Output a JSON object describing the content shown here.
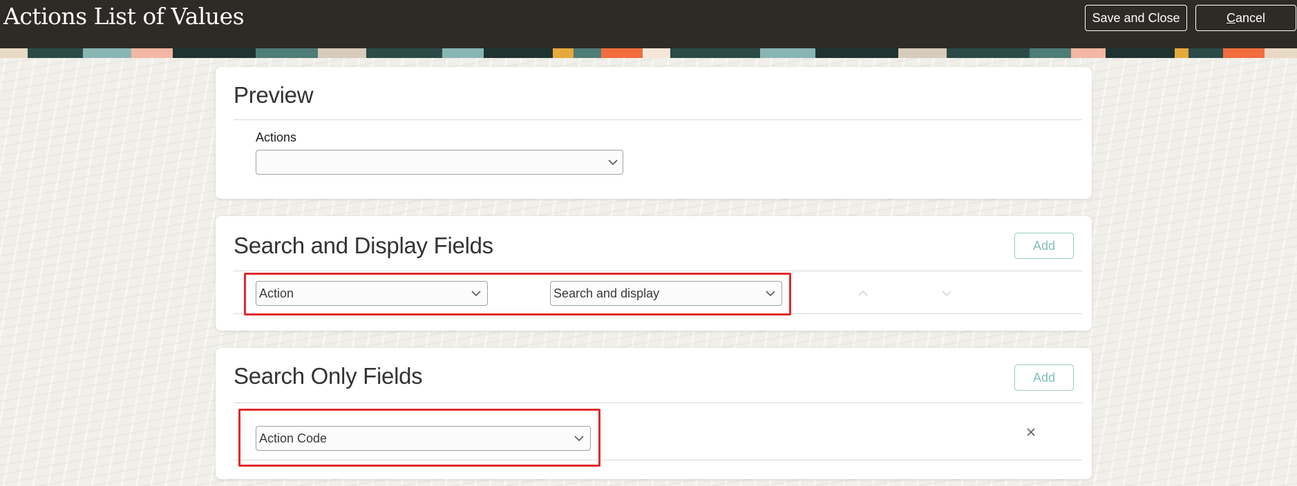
{
  "header": {
    "title": "Actions List of Values",
    "save_label": "Save and Close",
    "cancel_accel": "C",
    "cancel_rest": "ancel",
    "banner_colors": [
      "#2b4a48",
      "#e8d9c4",
      "#88b6b3",
      "#f26d3d",
      "#f3b7a3",
      "#1f3331",
      "#d7ccbc",
      "#e7a93b",
      "#4e7c77",
      "#f7e7d9"
    ]
  },
  "preview": {
    "title": "Preview",
    "field_label": "Actions",
    "field_value": ""
  },
  "search_display": {
    "title": "Search and Display Fields",
    "add_label": "Add",
    "row": {
      "field": "Action",
      "mode": "Search and display",
      "move_up_icon": "chevron-up-icon",
      "move_down_icon": "chevron-down-icon"
    }
  },
  "search_only": {
    "title": "Search Only Fields",
    "add_label": "Add",
    "row": {
      "field": "Action Code",
      "remove_icon": "close-icon"
    }
  },
  "colors": {
    "header_bg": "#2e2a26",
    "highlight": "#e0292c",
    "add_button_text": "#7dbfb8"
  }
}
